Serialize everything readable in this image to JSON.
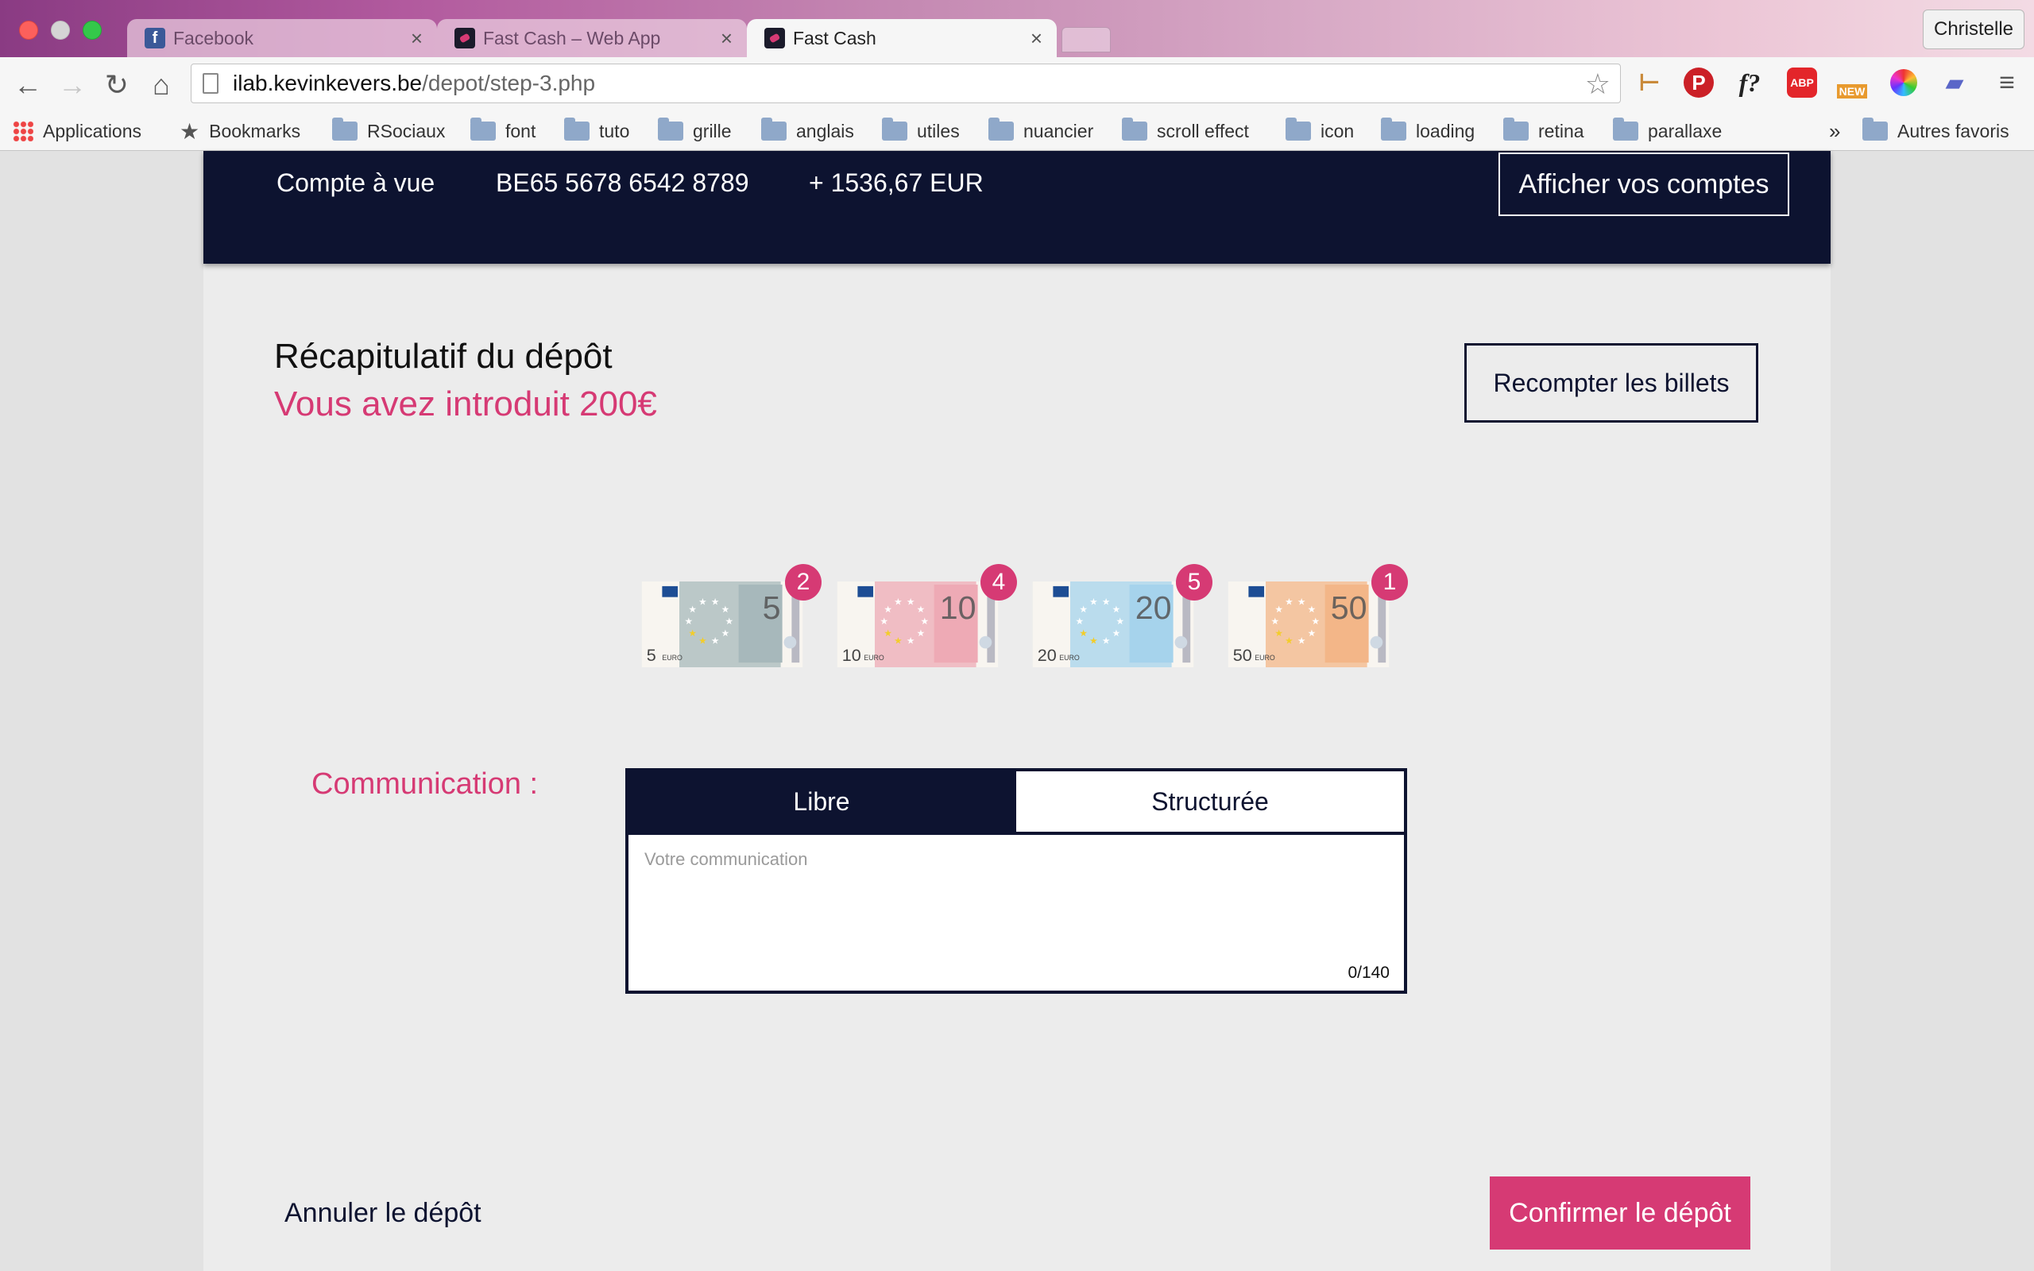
{
  "browser": {
    "tabs": [
      {
        "title": "Facebook",
        "icon": "facebook-icon",
        "active": false
      },
      {
        "title": "Fast Cash – Web App",
        "icon": "fastcash-icon",
        "active": false
      },
      {
        "title": "Fast Cash",
        "icon": "fastcash-icon",
        "active": true
      }
    ],
    "user": "Christelle",
    "url_host": "ilab.kevinkevers.be",
    "url_path": "/depot/step-3.php",
    "bookmarks": [
      {
        "label": "Applications",
        "icon": "apps-icon"
      },
      {
        "label": "Bookmarks",
        "icon": "star-icon"
      },
      {
        "label": "RSociaux",
        "icon": "folder-icon"
      },
      {
        "label": "font",
        "icon": "folder-icon"
      },
      {
        "label": "tuto",
        "icon": "folder-icon"
      },
      {
        "label": "grille",
        "icon": "folder-icon"
      },
      {
        "label": "anglais",
        "icon": "folder-icon"
      },
      {
        "label": "utiles",
        "icon": "folder-icon"
      },
      {
        "label": "nuancier",
        "icon": "folder-icon"
      },
      {
        "label": "scroll effect",
        "icon": "folder-icon"
      },
      {
        "label": "icon",
        "icon": "folder-icon"
      },
      {
        "label": "loading",
        "icon": "folder-icon"
      },
      {
        "label": "retina",
        "icon": "folder-icon"
      },
      {
        "label": "parallaxe",
        "icon": "folder-icon"
      }
    ],
    "bookmarks_overflow": "»",
    "other_bookmarks": "Autres favoris",
    "extensions": [
      "wooden-sign-icon",
      "pinterest-icon",
      "whatfont-icon",
      "adblock-icon",
      "new-badge-icon",
      "color-wheel-icon",
      "chat-bubble-icon",
      "menu-icon"
    ],
    "ext_labels": {
      "pinterest": "P",
      "whatfont": "f?",
      "adblock": "ABP",
      "new": "NEW"
    }
  },
  "account": {
    "type": "Compte à vue",
    "iban": "BE65 5678 6542 8789",
    "balance": "+ 1536,67 EUR",
    "show_accounts_label": "Afficher vos comptes"
  },
  "summary": {
    "title": "Récapitulatif du dépôt",
    "amount_text": "Vous avez introduit 200€",
    "recount_label": "Recompter les billets"
  },
  "notes": [
    {
      "denomination": "5",
      "count": "2",
      "color": "#a7b8bb"
    },
    {
      "denomination": "10",
      "count": "4",
      "color": "#eeaab5"
    },
    {
      "denomination": "20",
      "count": "5",
      "color": "#a6d3ec"
    },
    {
      "denomination": "50",
      "count": "1",
      "color": "#f3b688"
    }
  ],
  "note_currency": "EURO",
  "communication": {
    "label": "Communication :",
    "tabs": [
      "Libre",
      "Structurée"
    ],
    "placeholder": "Votre communication",
    "counter": "0/140"
  },
  "actions": {
    "cancel_label": "Annuler le dépôt",
    "confirm_label": "Confirmer le dépôt"
  },
  "colors": {
    "navy": "#0d1330",
    "accent": "#d63a74"
  }
}
